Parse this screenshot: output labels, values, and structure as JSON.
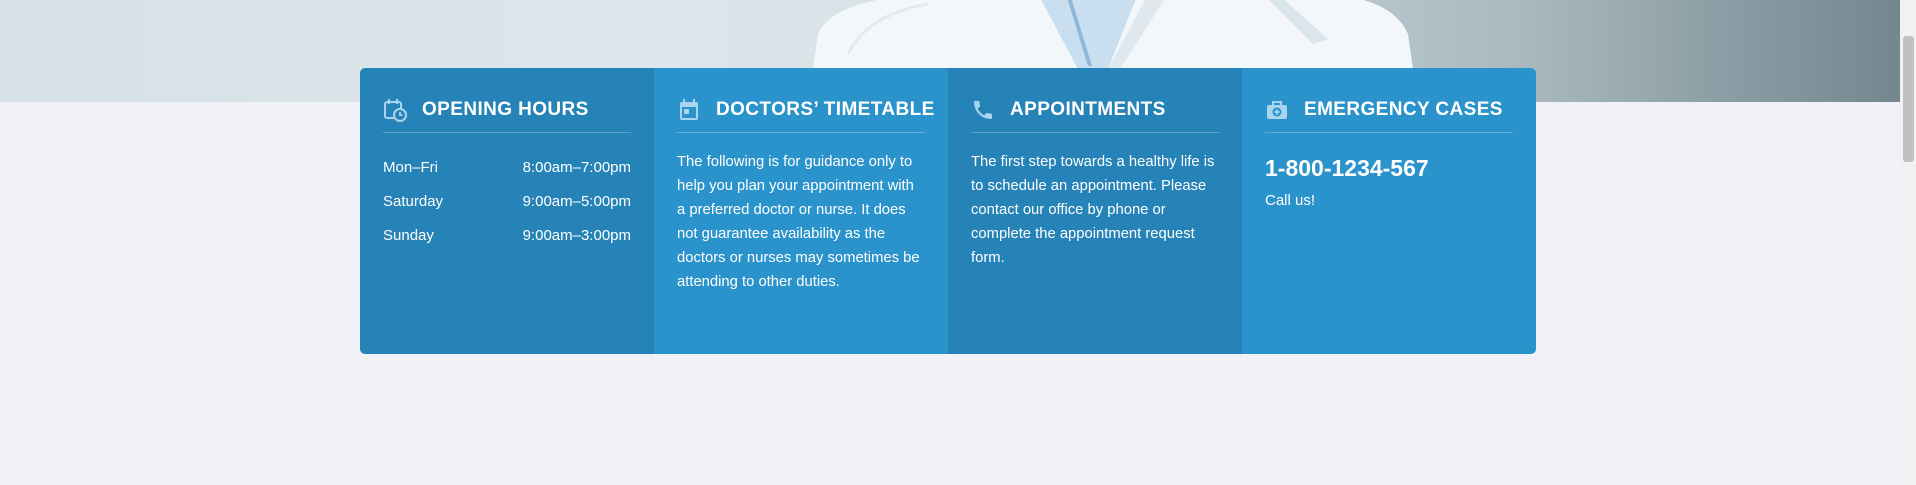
{
  "opening_hours": {
    "title": "Opening Hours",
    "icon": "calendar-clock-icon",
    "rows": [
      {
        "day": "Mon–Fri",
        "hours": "8:00am–7:00pm"
      },
      {
        "day": "Saturday",
        "hours": "9:00am–5:00pm"
      },
      {
        "day": "Sunday",
        "hours": "9:00am–3:00pm"
      }
    ]
  },
  "timetable": {
    "title": "Doctors’ Timetable",
    "icon": "calendar-icon",
    "text": "The following is for guidance only to help you plan your appointment with a preferred doctor or nurse. It does not guarantee availability as the doctors or nurses may sometimes be attending to other duties."
  },
  "appointments": {
    "title": "Appointments",
    "icon": "phone-icon",
    "text": "The first step towards a healthy life is to schedule an appointment. Please contact our office by phone or complete the appointment request form."
  },
  "emergency": {
    "title": "Emergency Cases",
    "icon": "medical-kit-icon",
    "phone": "1-800-1234-567",
    "note": "Call us!"
  },
  "colors": {
    "panel_dark": "#2583b7",
    "panel_light": "#2b93cb",
    "page_background": "#f0f2f7"
  }
}
